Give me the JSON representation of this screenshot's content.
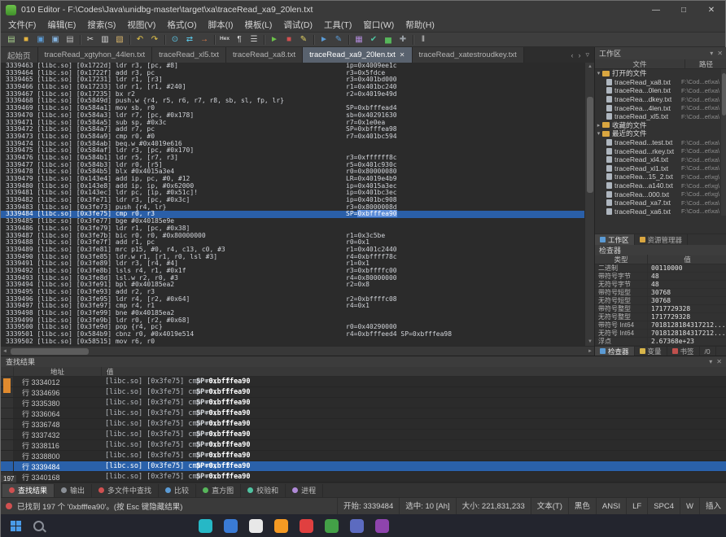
{
  "window": {
    "title": "010 Editor - F:\\Codes\\Java\\unidbg-master\\target\\xa\\traceRead_xa9_20len.txt",
    "minimize_icon": "—",
    "maximize_icon": "□",
    "close_icon": "✕"
  },
  "menu": {
    "items": [
      {
        "id": "file",
        "label": "文件(F)"
      },
      {
        "id": "edit",
        "label": "编辑(E)"
      },
      {
        "id": "search",
        "label": "搜索(S)"
      },
      {
        "id": "view",
        "label": "视图(V)"
      },
      {
        "id": "format",
        "label": "格式(O)"
      },
      {
        "id": "scripts",
        "label": "脚本(I)"
      },
      {
        "id": "templates",
        "label": "模板(L)"
      },
      {
        "id": "debug",
        "label": "调试(D)"
      },
      {
        "id": "tools",
        "label": "工具(T)"
      },
      {
        "id": "window",
        "label": "窗口(W)"
      },
      {
        "id": "help",
        "label": "帮助(H)"
      }
    ]
  },
  "toolbar": {
    "groups": [
      [
        {
          "id": "new-file",
          "glyph": "▤",
          "color": "#a9d18e"
        },
        {
          "id": "open-file",
          "glyph": "■",
          "color": "#e3b341"
        },
        {
          "id": "save",
          "glyph": "▣",
          "color": "#5b9bd5"
        },
        {
          "id": "save-all",
          "glyph": "▣",
          "color": "#85b4e0"
        },
        {
          "id": "print",
          "glyph": "▤",
          "color": "#b9b9b9"
        }
      ],
      [
        {
          "id": "cut",
          "glyph": "✂",
          "color": "#d6d6d6"
        },
        {
          "id": "copy",
          "glyph": "▥",
          "color": "#d6d6d6"
        },
        {
          "id": "paste",
          "glyph": "▧",
          "color": "#d9b56a"
        }
      ],
      [
        {
          "id": "undo",
          "glyph": "↶",
          "color": "#e8c84a"
        },
        {
          "id": "redo",
          "glyph": "↷",
          "color": "#e8c84a"
        }
      ],
      [
        {
          "id": "find",
          "glyph": "⊙",
          "color": "#5bc8e8"
        },
        {
          "id": "replace",
          "glyph": "⇄",
          "color": "#5bc8e8"
        },
        {
          "id": "goto-line",
          "glyph": "→",
          "color": "#e8824a"
        }
      ],
      [
        {
          "id": "hex-mode",
          "glyph": "Hex",
          "color": "#cfcfcf",
          "text": true
        },
        {
          "id": "paragraph-marks",
          "glyph": "¶",
          "color": "#cfcfcf"
        },
        {
          "id": "line-numbers",
          "glyph": "☰",
          "color": "#cfcfcf"
        }
      ],
      [
        {
          "id": "run-script",
          "glyph": "►",
          "color": "#6cc24a"
        },
        {
          "id": "stop-script",
          "glyph": "■",
          "color": "#d05050"
        },
        {
          "id": "edit-script",
          "glyph": "✎",
          "color": "#e0d060"
        }
      ],
      [
        {
          "id": "run-template",
          "glyph": "►",
          "color": "#5b9bd5"
        },
        {
          "id": "edit-template",
          "glyph": "✎",
          "color": "#5b9bd5"
        }
      ],
      [
        {
          "id": "calculator",
          "glyph": "▦",
          "color": "#b08ad8"
        },
        {
          "id": "checksum",
          "glyph": "✔",
          "color": "#4fc3a1"
        },
        {
          "id": "histogram",
          "glyph": "▅",
          "color": "#57b65b"
        },
        {
          "id": "tools",
          "glyph": "✚",
          "color": "#9aa0a6"
        }
      ],
      [
        {
          "id": "pause",
          "glyph": "‖",
          "color": "#cfcfcf"
        }
      ]
    ]
  },
  "tabbar": {
    "tabs": [
      {
        "id": "start-page",
        "label": "起始页",
        "active": false
      },
      {
        "id": "traceread-xgtyhon-44len",
        "label": "traceRead_xgtyhon_44len.txt",
        "active": false
      },
      {
        "id": "traceread-xl5",
        "label": "traceRead_xl5.txt",
        "active": false
      },
      {
        "id": "traceread-xa8",
        "label": "traceRead_xa8.txt",
        "active": false
      },
      {
        "id": "traceread-xa9-20len",
        "label": "traceRead_xa9_20len.txt",
        "active": true
      },
      {
        "id": "traceread-xatestroudkey",
        "label": "traceRead_xatestroudkey.txt",
        "active": false
      }
    ],
    "close_icon": "✕",
    "scroll_left_icon": "‹",
    "scroll_right_icon": "›",
    "list_icon": "▿"
  },
  "editor": {
    "match_text": "0xbfffea90",
    "highlight_line": "3339484",
    "scroll_icons": {
      "up": "▲",
      "down": "▼",
      "left": "◄",
      "right": "►"
    },
    "lines": [
      {
        "n": "3339463",
        "m": "[libc.so]",
        "a": "[0x1722d]",
        "s": "ldr r3, [pc, #8]",
        "r": "ip=0x4009ee1c"
      },
      {
        "n": "3339464",
        "m": "[libc.so]",
        "a": "[0x1722f]",
        "s": "add r3, pc",
        "r": "r3=0x5fdce"
      },
      {
        "n": "3339465",
        "m": "[libc.so]",
        "a": "[0x17231]",
        "s": "ldr r1, [r3]",
        "r": "r3=0x401bd000"
      },
      {
        "n": "3339466",
        "m": "[libc.so]",
        "a": "[0x17233]",
        "s": "ldr r1, [r1, #240]",
        "r": "r1=0x401bc240"
      },
      {
        "n": "3339467",
        "m": "[libc.so]",
        "a": "[0x17235]",
        "s": "bx r2",
        "r": "r2=0x4019e49d"
      },
      {
        "n": "3339468",
        "m": "[libc.so]",
        "a": "[0x5849d]",
        "s": "push.w {r4, r5, r6, r7, r8, sb, sl, fp, lr}",
        "r": ""
      },
      {
        "n": "3339469",
        "m": "[libc.so]",
        "a": "[0x584a1]",
        "s": "mov sb, r0",
        "r": "SP=0xbfffead4"
      },
      {
        "n": "3339470",
        "m": "[libc.so]",
        "a": "[0x584a3]",
        "s": "ldr r7, [pc, #0x178]",
        "r": "sb=0x40291630"
      },
      {
        "n": "3339471",
        "m": "[libc.so]",
        "a": "[0x584a5]",
        "s": "sub sp, #0x3c",
        "r": "r7=0x1e0ea"
      },
      {
        "n": "3339472",
        "m": "[libc.so]",
        "a": "[0x584a7]",
        "s": "add r7, pc",
        "r": "SP=0xbfffea98"
      },
      {
        "n": "3339473",
        "m": "[libc.so]",
        "a": "[0x584a9]",
        "s": "cmp r0, #0",
        "r": "r7=0x401bc594"
      },
      {
        "n": "3339474",
        "m": "[libc.so]",
        "a": "[0x584ab]",
        "s": "beq.w #0x4019e616",
        "r": ""
      },
      {
        "n": "3339475",
        "m": "[libc.so]",
        "a": "[0x584af]",
        "s": "ldr r3, [pc, #0x170]",
        "r": ""
      },
      {
        "n": "3339476",
        "m": "[libc.so]",
        "a": "[0x584b1]",
        "s": "ldr r5, [r7, r3]",
        "r": "r3=0xffffff8c"
      },
      {
        "n": "3339477",
        "m": "[libc.so]",
        "a": "[0x584b3]",
        "s": "ldr r0, [r5]",
        "r": "r5=0x401c930c"
      },
      {
        "n": "3339478",
        "m": "[libc.so]",
        "a": "[0x584b5]",
        "s": "blx #0x4015a3e4",
        "r": "r0=0x80000080"
      },
      {
        "n": "3339479",
        "m": "[libc.so]",
        "a": "[0x143e4]",
        "s": "add ip, pc, #0, #12",
        "r": "LR=0x4019e4b9"
      },
      {
        "n": "3339480",
        "m": "[libc.so]",
        "a": "[0x143e8]",
        "s": "add ip, ip, #0x62000",
        "r": "ip=0x4015a3ec"
      },
      {
        "n": "3339481",
        "m": "[libc.so]",
        "a": "[0x143ec]",
        "s": "ldr pc, [ip, #0x51c]!",
        "r": "ip=0x401bc3ec"
      },
      {
        "n": "3339482",
        "m": "[libc.so]",
        "a": "[0x3fe71]",
        "s": "ldr r3, [pc, #0x3c]",
        "r": "ip=0x401bc908"
      },
      {
        "n": "3339483",
        "m": "[libc.so]",
        "a": "[0x3fe73]",
        "s": "push {r4, lr}",
        "r": "r3=0x8000008d"
      },
      {
        "n": "3339484",
        "m": "[libc.so]",
        "a": "[0x3fe75]",
        "s": "cmp r0, r3",
        "r": "SP=0xbfffea90"
      },
      {
        "n": "3339485",
        "m": "[libc.so]",
        "a": "[0x3fe77]",
        "s": "bge #0x40185e9e",
        "r": ""
      },
      {
        "n": "3339486",
        "m": "[libc.so]",
        "a": "[0x3fe79]",
        "s": "ldr r1, [pc, #0x38]",
        "r": ""
      },
      {
        "n": "3339487",
        "m": "[libc.so]",
        "a": "[0x3fe7b]",
        "s": "bic r0, r0, #0x80000000",
        "r": "r1=0x3c5be"
      },
      {
        "n": "3339488",
        "m": "[libc.so]",
        "a": "[0x3fe7f]",
        "s": "add r1, pc",
        "r": "r0=0x1"
      },
      {
        "n": "3339489",
        "m": "[libc.so]",
        "a": "[0x3fe81]",
        "s": "mrc p15, #0, r4, c13, c0, #3",
        "r": "r1=0x401c2440"
      },
      {
        "n": "3339490",
        "m": "[libc.so]",
        "a": "[0x3fe85]",
        "s": "ldr.w r1, [r1, r0, lsl #3]",
        "r": "r4=0xbffff78c"
      },
      {
        "n": "3339491",
        "m": "[libc.so]",
        "a": "[0x3fe89]",
        "s": "ldr r3, [r4, #4]",
        "r": "r1=0x1"
      },
      {
        "n": "3339492",
        "m": "[libc.so]",
        "a": "[0x3fe8b]",
        "s": "lsls r4, r1, #0x1f",
        "r": "r3=0xbffffc00"
      },
      {
        "n": "3339493",
        "m": "[libc.so]",
        "a": "[0x3fe8d]",
        "s": "lsl.w r2, r0, #3",
        "r": "r4=0x80000000"
      },
      {
        "n": "3339494",
        "m": "[libc.so]",
        "a": "[0x3fe91]",
        "s": "bpl #0x40185ea2",
        "r": "r2=0x8"
      },
      {
        "n": "3339495",
        "m": "[libc.so]",
        "a": "[0x3fe93]",
        "s": "add r2, r3",
        "r": ""
      },
      {
        "n": "3339496",
        "m": "[libc.so]",
        "a": "[0x3fe95]",
        "s": "ldr r4, [r2, #0x64]",
        "r": "r2=0xbffffc08"
      },
      {
        "n": "3339497",
        "m": "[libc.so]",
        "a": "[0x3fe97]",
        "s": "cmp r4, r1",
        "r": "r4=0x1"
      },
      {
        "n": "3339498",
        "m": "[libc.so]",
        "a": "[0x3fe99]",
        "s": "bne #0x40185ea2",
        "r": ""
      },
      {
        "n": "3339499",
        "m": "[libc.so]",
        "a": "[0x3fe9b]",
        "s": "ldr r0, [r2, #0x68]",
        "r": ""
      },
      {
        "n": "3339500",
        "m": "[libc.so]",
        "a": "[0x3fe9d]",
        "s": "pop {r4, pc}",
        "r": "r0=0x40290000"
      },
      {
        "n": "3339501",
        "m": "[libc.so]",
        "a": "[0x584b9]",
        "s": "cbnz r0, #0x4019e514",
        "r": "r4=0xbfffeed4 SP=0xbfffea98"
      },
      {
        "n": "3339502",
        "m": "[libc.so]",
        "a": "[0x58515]",
        "s": "mov r6, r0",
        "r": ""
      }
    ]
  },
  "workspace": {
    "title": "工作区",
    "collapse_icon": "▾",
    "close_icon": "✕",
    "columns": [
      "文件",
      "路径"
    ],
    "arrow_expanded": "▾",
    "arrow_collapsed": "▸",
    "sections": [
      {
        "id": "open-files",
        "label": "打开的文件",
        "expanded": true,
        "files": [
          {
            "name": "traceRead_xa8.txt",
            "path": "F:\\Cod...et\\xa\\"
          },
          {
            "name": "traceRea...0len.txt",
            "path": "F:\\Cod...et\\xa\\"
          },
          {
            "name": "traceRea...dkey.txt",
            "path": "F:\\Cod...et\\xa\\"
          },
          {
            "name": "traceRea...4len.txt",
            "path": "F:\\Cod...et\\xa\\"
          },
          {
            "name": "traceRead_xl5.txt",
            "path": "F:\\Cod...et\\xa\\"
          }
        ]
      },
      {
        "id": "favorite-files",
        "label": "收藏的文件",
        "expanded": false,
        "files": []
      },
      {
        "id": "recent-files",
        "label": "最近的文件",
        "expanded": true,
        "files": [
          {
            "name": "traceRead...test.txt",
            "path": "F:\\Cod...et\\xa\\"
          },
          {
            "name": "traceRead...rkey.txt",
            "path": "F:\\Cod...et\\xa\\"
          },
          {
            "name": "traceRead_xl4.txt",
            "path": "F:\\Cod...et\\xa\\"
          },
          {
            "name": "traceRead_xl1.txt",
            "path": "F:\\Cod...et\\xa\\"
          },
          {
            "name": "traceRea...15_2.txt",
            "path": "F:\\Cod...et\\xg\\"
          },
          {
            "name": "traceRea...a140.txt",
            "path": "F:\\Cod...et\\xg\\"
          },
          {
            "name": "traceRea...000.txt",
            "path": "F:\\Cod...et\\xg\\"
          },
          {
            "name": "traceRead_xa7.txt",
            "path": "F:\\Cod...et\\xa\\"
          },
          {
            "name": "traceRead_xa6.txt",
            "path": "F:\\Cod...et\\xa\\"
          }
        ]
      }
    ],
    "bottom_tabs": [
      {
        "id": "workspace",
        "label": "工作区",
        "active": true,
        "color": "#5b9bd5"
      },
      {
        "id": "explorer",
        "label": "资源管理器",
        "active": false,
        "color": "#d9a640"
      }
    ]
  },
  "inspector": {
    "title": "检查器",
    "columns": [
      "类型",
      "值"
    ],
    "rows": [
      [
        "二进制",
        "00110000"
      ],
      [
        "带符号字节",
        "48"
      ],
      [
        "无符号字节",
        "48"
      ],
      [
        "带符号短型",
        "30768"
      ],
      [
        "无符号短型",
        "30768"
      ],
      [
        "带符号整型",
        "1717729328"
      ],
      [
        "无符号整型",
        "1717729328"
      ],
      [
        "带符号 Int64",
        "7018128184317212..."
      ],
      [
        "无符号 Int64",
        "7018128184317212..."
      ],
      [
        "浮点",
        "2.67368e+23"
      ]
    ],
    "bottom_tabs": [
      {
        "id": "inspector",
        "label": "检查器",
        "active": true,
        "color": "#5b9bd5"
      },
      {
        "id": "variables",
        "label": "变量",
        "active": false,
        "color": "#d8b54a"
      },
      {
        "id": "bookmarks",
        "label": "书签",
        "active": false,
        "color": "#c0504d"
      },
      {
        "id": "overflow",
        "label": "/0",
        "active": false,
        "color": ""
      }
    ]
  },
  "find_results": {
    "title": "查找结果",
    "collapse_icon": "▾",
    "close_icon": "✕",
    "columns": [
      "地址",
      "值"
    ],
    "line_prefix": "行 ",
    "match_text": "0xbfffea90",
    "result_count": "197",
    "rows": [
      {
        "line": "3334012",
        "text": "[libc.so] [0x3fe75] cmp r0, r3",
        "sp": "SP=0xbfffea90",
        "selected": false
      },
      {
        "line": "3334696",
        "text": "[libc.so] [0x3fe75] cmp r0, r3",
        "sp": "SP=0xbfffea90",
        "selected": false
      },
      {
        "line": "3335380",
        "text": "[libc.so] [0x3fe75] cmp r0, r3",
        "sp": "SP=0xbfffea90",
        "selected": false
      },
      {
        "line": "3336064",
        "text": "[libc.so] [0x3fe75] cmp r0, r3",
        "sp": "SP=0xbfffea90",
        "selected": false
      },
      {
        "line": "3336748",
        "text": "[libc.so] [0x3fe75] cmp r0, r3",
        "sp": "SP=0xbfffea90",
        "selected": false
      },
      {
        "line": "3337432",
        "text": "[libc.so] [0x3fe75] cmp r0, r3",
        "sp": "SP=0xbfffea90",
        "selected": false
      },
      {
        "line": "3338116",
        "text": "[libc.so] [0x3fe75] cmp r0, r3",
        "sp": "SP=0xbfffea90",
        "selected": false
      },
      {
        "line": "3338800",
        "text": "[libc.so] [0x3fe75] cmp r0, r3",
        "sp": "SP=0xbfffea90",
        "selected": false
      },
      {
        "line": "3339484",
        "text": "[libc.so] [0x3fe75] cmp r0, r3",
        "sp": "SP=0xbfffea90",
        "selected": true
      },
      {
        "line": "3340168",
        "text": "[libc.so] [0x3fe75] cmp r0, r3",
        "sp": "SP=0xbfffea90",
        "selected": false
      }
    ]
  },
  "panel_tabs": [
    {
      "id": "find-results",
      "label": "查找结果",
      "active": true,
      "color": "#d05050"
    },
    {
      "id": "output",
      "label": "输出",
      "active": false,
      "color": "#8a8f96"
    },
    {
      "id": "find-in-files",
      "label": "多文件中查找",
      "active": false,
      "color": "#d05050"
    },
    {
      "id": "compare",
      "label": "比较",
      "active": false,
      "color": "#5b9bd5"
    },
    {
      "id": "histogram",
      "label": "直方图",
      "active": false,
      "color": "#57b65b"
    },
    {
      "id": "checksum",
      "label": "校验和",
      "active": false,
      "color": "#4fc3a1"
    },
    {
      "id": "processes",
      "label": "进程",
      "active": false,
      "color": "#b08ad8"
    }
  ],
  "status": {
    "message": "已找到 197 个 '0xbfffea90'。(按 Esc 键隐藏结果)",
    "segments": [
      {
        "id": "start",
        "text": "开始: 3339484",
        "interactable": false
      },
      {
        "id": "selection",
        "text": "选中: 10 [Ah]",
        "interactable": false
      },
      {
        "id": "size",
        "text": "大小: 221,831,233",
        "interactable": false
      },
      {
        "id": "edit-mode",
        "text": "文本(T)",
        "interactable": true
      },
      {
        "id": "theme",
        "text": "黑色",
        "interactable": true
      },
      {
        "id": "encoding",
        "text": "ANSI",
        "interactable": true
      },
      {
        "id": "line-ending",
        "text": "LF",
        "interactable": true
      },
      {
        "id": "tab-size",
        "text": "SPC4",
        "interactable": true
      },
      {
        "id": "caps",
        "text": "W",
        "interactable": false
      },
      {
        "id": "insert-mode",
        "text": "插入",
        "interactable": true
      }
    ]
  },
  "taskbar": {
    "icons": [
      "#26b8c6",
      "#3a7bd5",
      "#e8e8e8",
      "#f59a23",
      "#e04040",
      "#43a047",
      "#5c6bc0",
      "#8e44ad"
    ]
  }
}
